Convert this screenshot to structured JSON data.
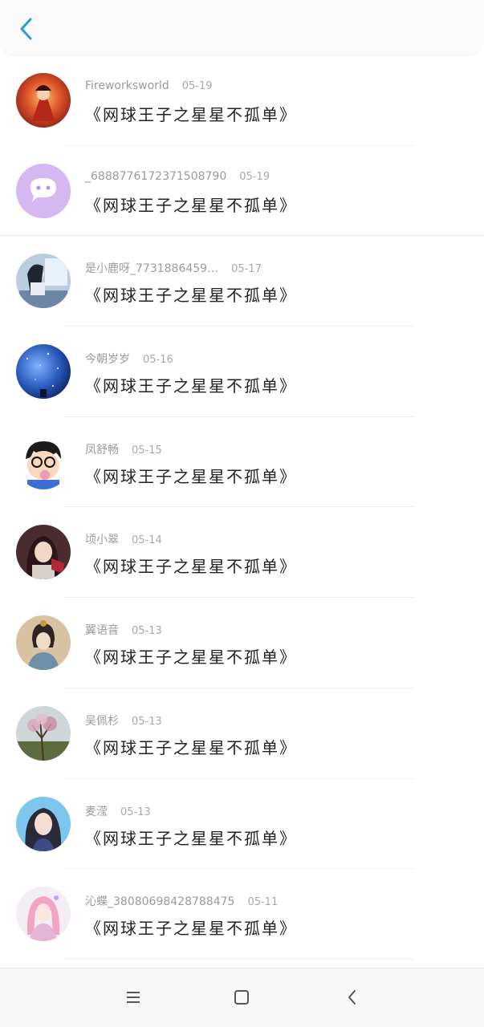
{
  "colors": {
    "accent": "#2d9cdb",
    "meta_text": "#9a9a9a",
    "title_text": "#222222"
  },
  "header": {
    "back_icon": "chevron-left-icon"
  },
  "items": [
    {
      "username": "Fireworksworld",
      "date": "05-19",
      "title": "《网球王子之星星不孤单》",
      "avatar": "flame-character-avatar"
    },
    {
      "username": "_6888776172371508790",
      "date": "05-19",
      "title": "《网球王子之星星不孤单》",
      "avatar": "default-chat-bubble-avatar"
    },
    {
      "username": "是小鹿呀_7731886459…",
      "date": "05-17",
      "title": "《网球王子之星星不孤单》",
      "avatar": "anime-girl-window-avatar"
    },
    {
      "username": "今朝岁岁",
      "date": "05-16",
      "title": "《网球王子之星星不孤单》",
      "avatar": "starry-sky-avatar"
    },
    {
      "username": "凤舒畅",
      "date": "05-15",
      "title": "《网球王子之星星不孤单》",
      "avatar": "cartoon-boy-glasses-avatar"
    },
    {
      "username": "顷小翠",
      "date": "05-14",
      "title": "《网球王子之星星不孤单》",
      "avatar": "girl-portrait-avatar"
    },
    {
      "username": "翼语音",
      "date": "05-13",
      "title": "《网球王子之星星不孤单》",
      "avatar": "ancient-lady-avatar"
    },
    {
      "username": "吴佩杉",
      "date": "05-13",
      "title": "《网球王子之星星不孤单》",
      "avatar": "blossom-tree-avatar"
    },
    {
      "username": "麦滢",
      "date": "05-13",
      "title": "《网球王子之星星不孤单》",
      "avatar": "selfie-girl-avatar"
    },
    {
      "username": "沁蝶_38080698428788475",
      "date": "05-11",
      "title": "《网球王子之星星不孤单》",
      "avatar": "pink-hair-girl-avatar"
    }
  ],
  "navbar": {
    "menu_icon": "menu-icon",
    "home_icon": "home-square-icon",
    "back_icon": "back-arrow-icon"
  }
}
